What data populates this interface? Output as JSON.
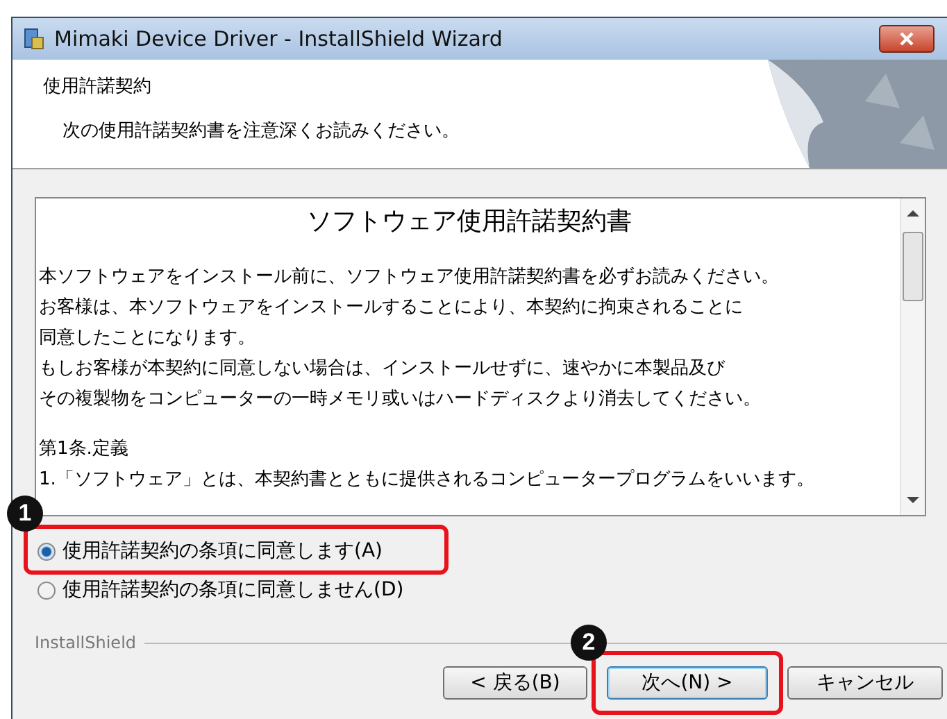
{
  "window": {
    "title": "Mimaki Device Driver - InstallShield Wizard"
  },
  "header": {
    "title": "使用許諾契約",
    "subtitle": "次の使用許諾契約書を注意深くお読みください。"
  },
  "license": {
    "heading": "ソフトウェア使用許諾契約書",
    "paragraphs": [
      {
        "lines": [
          "本ソフトウェアをインストール前に、ソフトウェア使用許諾契約書を必ずお読みください。",
          "お客様は、本ソフトウェアをインストールすることにより、本契約に拘束されることに",
          "同意したことになります。",
          "もしお客様が本契約に同意しない場合は、インストールせずに、速やかに本製品及び",
          "その複製物をコンピューターの一時メモリ或いはハードディスクより消去してください。"
        ]
      },
      {
        "lines": [
          "第1条.定義",
          " 1.「ソフトウェア」とは、本契約書とともに提供されるコンピュータープログラムをいいます。"
        ]
      }
    ]
  },
  "options": [
    {
      "label": "使用許諾契約の条項に同意します(A)",
      "selected": true,
      "callout": "1"
    },
    {
      "label": "使用許諾契約の条項に同意しません(D)",
      "selected": false
    }
  ],
  "group_label": "InstallShield",
  "buttons": [
    {
      "label": "< 戻る(B)",
      "default": false
    },
    {
      "label": "次へ(N) >",
      "default": true,
      "callout": "2"
    },
    {
      "label": "キャンセル",
      "default": false
    }
  ]
}
